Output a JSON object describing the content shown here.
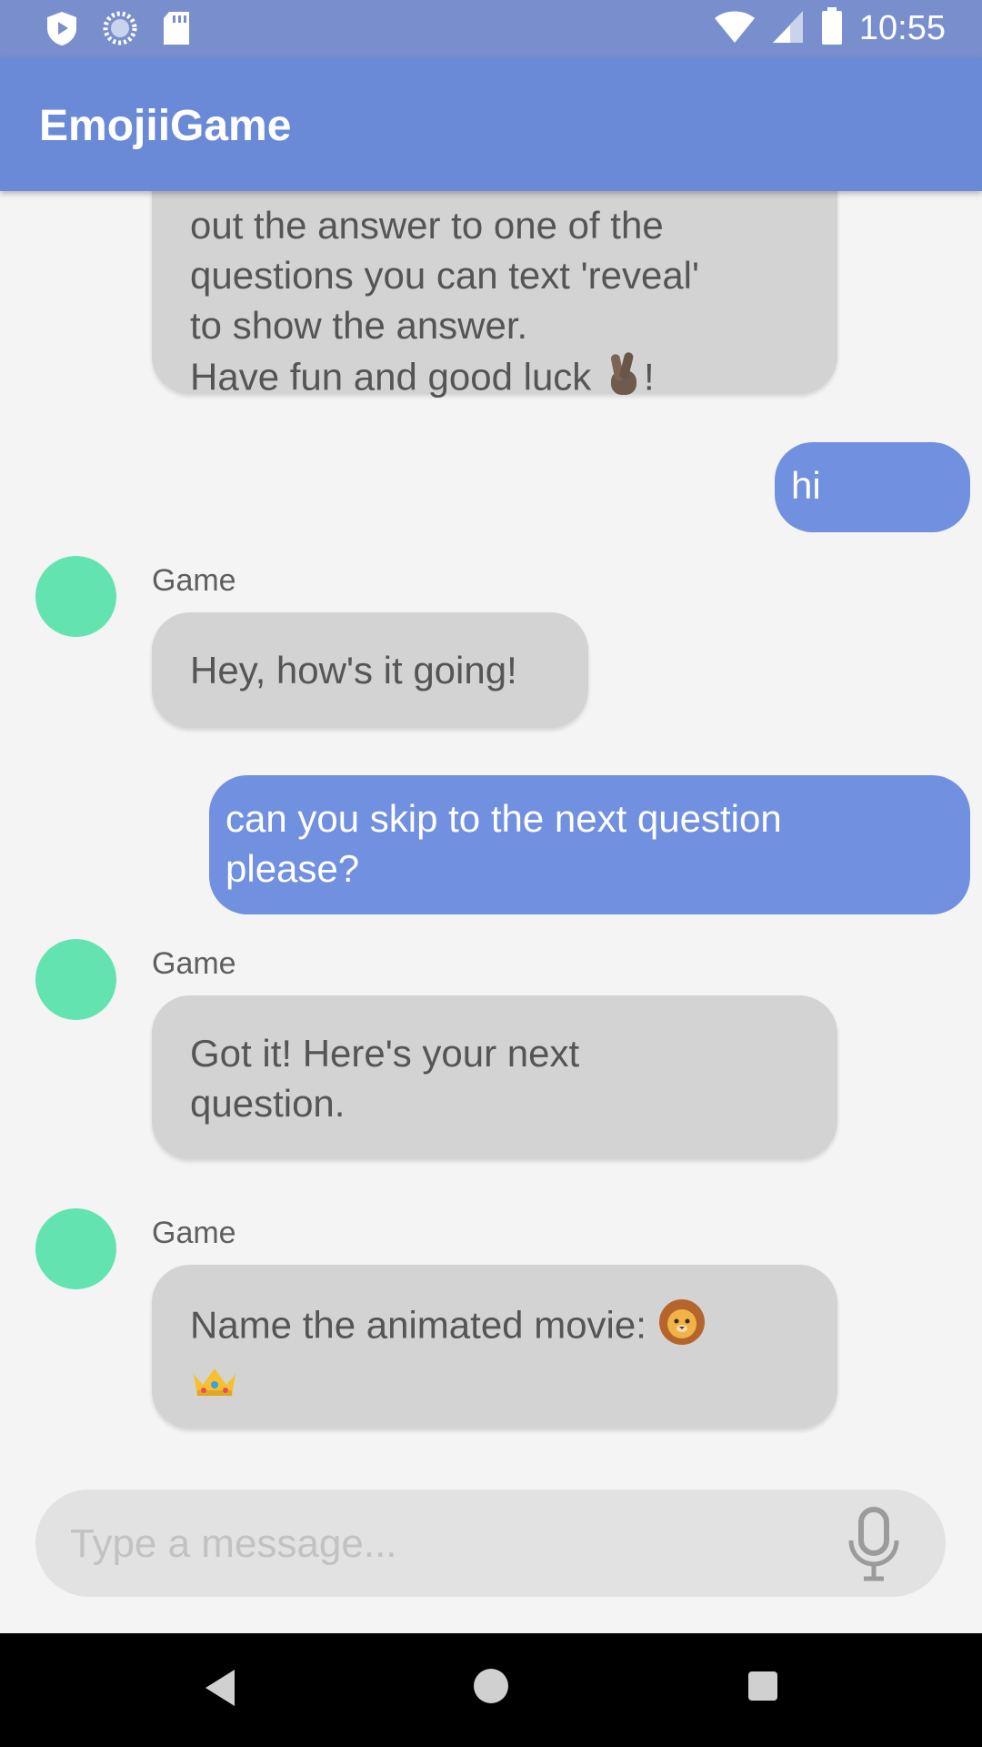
{
  "status_bar": {
    "time": "10:55",
    "left_icons": [
      "play-protect-icon",
      "sync-spinner-icon",
      "sd-card-icon"
    ],
    "right_icons": [
      "wifi-icon",
      "cell-signal-icon",
      "battery-icon"
    ]
  },
  "app_bar": {
    "title": "EmojiiGame"
  },
  "messages": [
    {
      "direction": "incoming",
      "lines": [
        "out the answer to one of the",
        "questions you can text 'reveal'",
        "to show the answer.",
        "Have fun and good luck"
      ],
      "trailing_emoji": "crossed-fingers-emoji",
      "trailing_text": "!"
    },
    {
      "direction": "outgoing",
      "text": "hi"
    },
    {
      "direction": "incoming",
      "sender": "Game",
      "text": "Hey, how's it going!"
    },
    {
      "direction": "outgoing",
      "lines": [
        "can you skip to the next question",
        "please?"
      ]
    },
    {
      "direction": "incoming",
      "sender": "Game",
      "lines": [
        "Got it! Here's your next",
        "question."
      ]
    },
    {
      "direction": "incoming",
      "sender": "Game",
      "text": "Name the animated movie:",
      "emojis": [
        "lion-face-emoji",
        "crown-emoji"
      ]
    }
  ],
  "composer": {
    "placeholder": "Type a message...",
    "mic_icon": "microphone-icon"
  },
  "nav_bar": {
    "icons": [
      "back-icon",
      "home-icon",
      "recents-icon"
    ]
  },
  "colors": {
    "status_bar": "#798fcd",
    "app_bar": "#6a8ad8",
    "incoming_bubble": "#d3d3d3",
    "outgoing_bubble": "#7190df",
    "avatar": "#62e3b0",
    "background": "#f4f4f4"
  }
}
